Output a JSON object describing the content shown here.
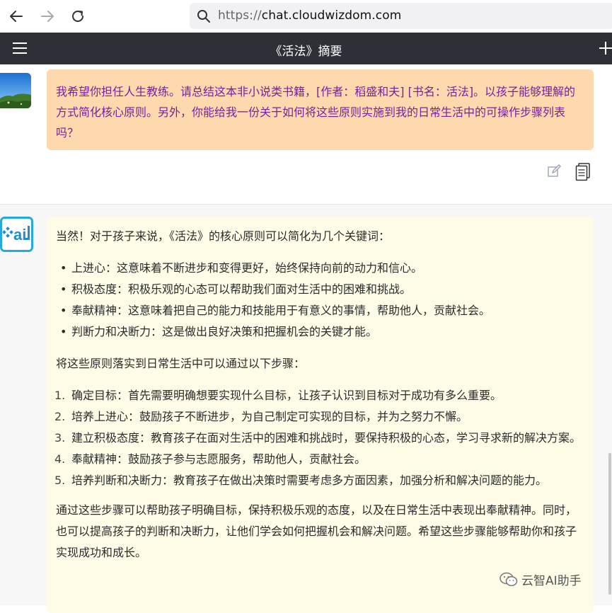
{
  "browser": {
    "url_scheme": "https://",
    "url_host": "chat.cloudwizdom.com",
    "icons": {
      "back": "arrow-left-icon",
      "forward": "arrow-right-icon",
      "reload": "reload-icon",
      "search": "search-icon"
    }
  },
  "header": {
    "title": "《活法》摘要",
    "icons": {
      "menu": "hamburger-menu-icon",
      "new": "plus-icon"
    }
  },
  "user_message": {
    "text": "我希望你担任人生教练。请总结这本非小说类书籍，[作者：稻盛和夫] [书名：活法]。以孩子能够理解的方式简化核心原则。另外，你能给我一份关于如何将这些原则实施到我的日常生活中的可操作步骤列表吗？",
    "bubble_color": "#fdd9ad",
    "text_color": "#7a1fa0",
    "icons": {
      "avatar": "landscape-avatar-icon",
      "edit": "edit-icon",
      "copy": "copy-icon"
    }
  },
  "ai_message": {
    "intro": "当然！对于孩子来说，《活法》的核心原则可以简化为几个关键词：",
    "bullets": [
      "上进心：这意味着不断进步和变得更好，始终保持向前的动力和信心。",
      "积极态度：积极乐观的心态可以帮助我们面对生活中的困难和挑战。",
      "奉献精神：这意味着把自己的能力和技能用于有意义的事情，帮助他人，贡献社会。",
      "判断力和决断力：这是做出良好决策和把握机会的关键才能。"
    ],
    "steps_intro": "将这些原则落实到日常生活中可以通过以下步骤：",
    "steps": [
      {
        "num": "1.",
        "text": "确定目标：首先需要明确想要实现什么目标，让孩子认识到目标对于成功有多么重要。"
      },
      {
        "num": "2.",
        "text": "培养上进心：鼓励孩子不断进步，为自己制定可实现的目标，并为之努力不懈。"
      },
      {
        "num": "3.",
        "text": "建立积极态度：教育孩子在面对生活中的困难和挑战时，要保持积极的心态，学习寻求新的解决方案。"
      },
      {
        "num": "4.",
        "text": "奉献精神：鼓励孩子参与志愿服务，帮助他人，贡献社会。"
      },
      {
        "num": "5.",
        "text": "培养判断和决断力：教育孩子在做出决策时需要考虑多方面因素，加强分析和解决问题的能力。"
      }
    ],
    "conclusion": "通过这些步骤可以帮助孩子明确目标，保持积极乐观的态度，以及在日常生活中表现出奉献精神。同时，也可以提高孩子的判断和决断力，让他们学会如何把握机会和解决问题。希望这些步骤能够帮助你和孩子实现成功和成长。",
    "bubble_color": "#fefbe7",
    "icons": {
      "avatar": "ai-logo-icon"
    }
  },
  "watermark": {
    "text": "云智AI助手",
    "icon": "wechat-icon"
  }
}
